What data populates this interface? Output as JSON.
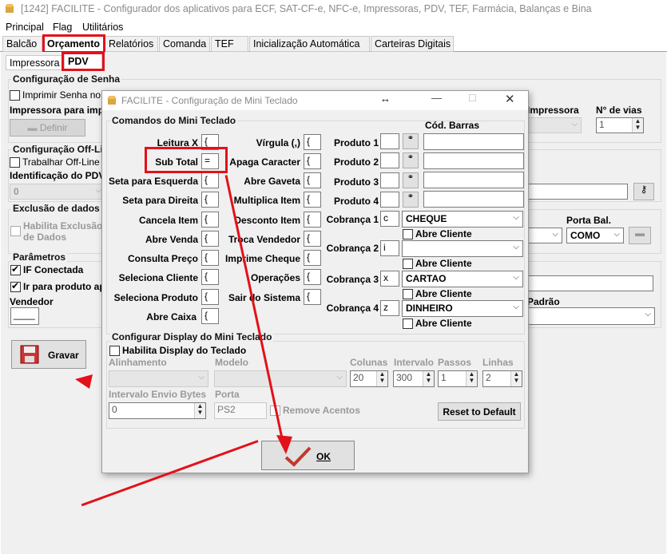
{
  "window": {
    "title": "[1242] FACILITE - Configurador dos aplicativos para ECF, SAT-CF-e, NFC-e, Impressoras, PDV, TEF, Farmácia, Balanças e Bina"
  },
  "menu": [
    "Principal",
    "Flag",
    "Utilitários"
  ],
  "tabs": [
    "Balcão",
    "Orçamento",
    "Relatórios",
    "Comanda",
    "TEF",
    "Inicialização Automática",
    "Carteiras Digitais"
  ],
  "subtabs": [
    "Impressora",
    "PDV"
  ],
  "main": {
    "senha_group": "Configuração de Senha",
    "imprimir_senha": "Imprimir Senha no",
    "impressora_para": "Impressora para impr",
    "definir": "Definir",
    "impressora_right": "Impressora",
    "n_vias_label": "N° de vias",
    "n_vias_value": "1",
    "offline_group": "Configuração Off-Lin",
    "trabalhar_offline": "Trabalhar Off-Line",
    "identificacao_pdv": "Identificação do PDV",
    "identificacao_value": "0",
    "exclusao_group": "Exclusão de dados",
    "habilita_exclusao_1": "Habilita Exclusão",
    "habilita_exclusao_2": "de Dados",
    "porta_bal_label": "Porta Bal.",
    "porta_bal_value": "COMO",
    "parametros_group": "Parâmetros",
    "ecf_conectada": "IF Conectada",
    "ir_produto": "Ir para produto ap",
    "vendedor": "Vendedor",
    "vendedor_value": "____",
    "padrao_label": "Padrão",
    "gravar": "Gravar"
  },
  "dialog": {
    "title": "FACILITE - Configuração de Mini Teclado",
    "move_glyph": "↔",
    "comandos_group": "Comandos do Mini Teclado",
    "keys_col1": [
      {
        "label": "Leitura X",
        "key": "{"
      },
      {
        "label": "Sub Total",
        "key": "="
      },
      {
        "label": "Seta para Esquerda",
        "key": "{"
      },
      {
        "label": "Seta para Direita",
        "key": "{"
      },
      {
        "label": "Cancela Item",
        "key": "{"
      },
      {
        "label": "Abre Venda",
        "key": "{"
      },
      {
        "label": "Consulta Preço",
        "key": "{"
      },
      {
        "label": "Seleciona Cliente",
        "key": "{"
      },
      {
        "label": "Seleciona Produto",
        "key": "{"
      },
      {
        "label": "Abre Caixa",
        "key": "{"
      }
    ],
    "keys_col2": [
      {
        "label": "Vírgula (,)",
        "key": "{"
      },
      {
        "label": "Apaga Caracter",
        "key": "{"
      },
      {
        "label": "Abre Gaveta",
        "key": "{"
      },
      {
        "label": "Multiplica Item",
        "key": "{"
      },
      {
        "label": "Desconto Item",
        "key": "{"
      },
      {
        "label": "Troca Vendedor",
        "key": "{"
      },
      {
        "label": "Imprime Cheque",
        "key": "{"
      },
      {
        "label": "Operações",
        "key": "{"
      },
      {
        "label": "Sair do Sistema",
        "key": "{"
      }
    ],
    "cod_barras_label": "Cód. Barras",
    "produtos": [
      {
        "label": "Produto 1",
        "key": ""
      },
      {
        "label": "Produto 2",
        "key": ""
      },
      {
        "label": "Produto 3",
        "key": ""
      },
      {
        "label": "Produto 4",
        "key": ""
      }
    ],
    "cobrancas": [
      {
        "label": "Cobrança 1",
        "key": "c",
        "value": "CHEQUE",
        "abre_cliente": "Abre Cliente"
      },
      {
        "label": "Cobrança 2",
        "key": "i",
        "value": "",
        "abre_cliente": "Abre Cliente"
      },
      {
        "label": "Cobrança 3",
        "key": "x",
        "value": "CARTAO",
        "abre_cliente": "Abre Cliente"
      },
      {
        "label": "Cobrança 4",
        "key": "z",
        "value": "DINHEIRO",
        "abre_cliente": "Abre Cliente"
      }
    ],
    "display_group": "Configurar Display do Mini Teclado",
    "habilita_display": "Habilita Display do Teclado",
    "alinhamento": "Alinhamento",
    "modelo": "Modelo",
    "colunas_label": "Colunas",
    "colunas_value": "20",
    "intervalo_label": "Intervalo",
    "intervalo_value": "300",
    "passos_label": "Passos",
    "passos_value": "1",
    "linhas_label": "Linhas",
    "linhas_value": "2",
    "intervalo_envio_label": "Intervalo Envio Bytes",
    "intervalo_envio_value": "0",
    "porta_label": "Porta",
    "porta_value": "PS2",
    "remove_acentos": "Remove Acentos",
    "reset_button": "Reset to Default",
    "ok_button": "OK"
  },
  "colors": {
    "annotation": "#e3111a",
    "panel": "#f0f0f0"
  }
}
